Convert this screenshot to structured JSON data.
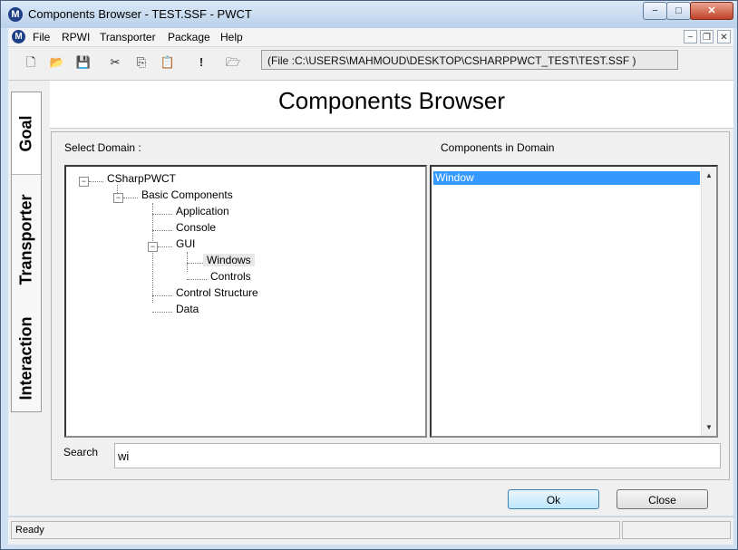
{
  "window": {
    "title": "Components Browser - TEST.SSF  - PWCT",
    "app_icon": "M",
    "minimize": "−",
    "maximize": "□",
    "close": "✕"
  },
  "menubar": {
    "icon": "M",
    "items": [
      "File",
      "RPWI",
      "Transporter",
      "Package",
      "Help"
    ],
    "mdi_minimize": "−",
    "mdi_restore": "❐",
    "mdi_close": "✕"
  },
  "toolbar": {
    "icons": [
      "new-file-icon",
      "open-folder-icon",
      "save-icon",
      "cut-icon",
      "copy-icon",
      "paste-icon",
      "exclamation-icon",
      "folder-up-icon"
    ],
    "glyphs": [
      "🗋",
      "📂",
      "💾",
      "✂",
      "⎘",
      "📋",
      "!",
      "🗁"
    ],
    "file_path": "(File :C:\\USERS\\MAHMOUD\\DESKTOP\\CSHARPPWCT_TEST\\TEST.SSF )"
  },
  "side_tabs": [
    "Goal",
    "Transporter",
    "Interaction"
  ],
  "header": {
    "title": "Components Browser"
  },
  "domain": {
    "label": "Select Domain :",
    "tree": {
      "root": "CSharpPWCT",
      "basic": "Basic Components",
      "application": "Application",
      "console": "Console",
      "gui": "GUI",
      "windows": "Windows",
      "controls": "Controls",
      "control_structure": "Control Structure",
      "data": "Data"
    }
  },
  "components": {
    "label": "Components in Domain",
    "items": [
      "Window"
    ]
  },
  "search": {
    "label": "Search",
    "value": "wi"
  },
  "buttons": {
    "ok": "Ok",
    "close": "Close"
  },
  "status": {
    "text": "Ready"
  }
}
